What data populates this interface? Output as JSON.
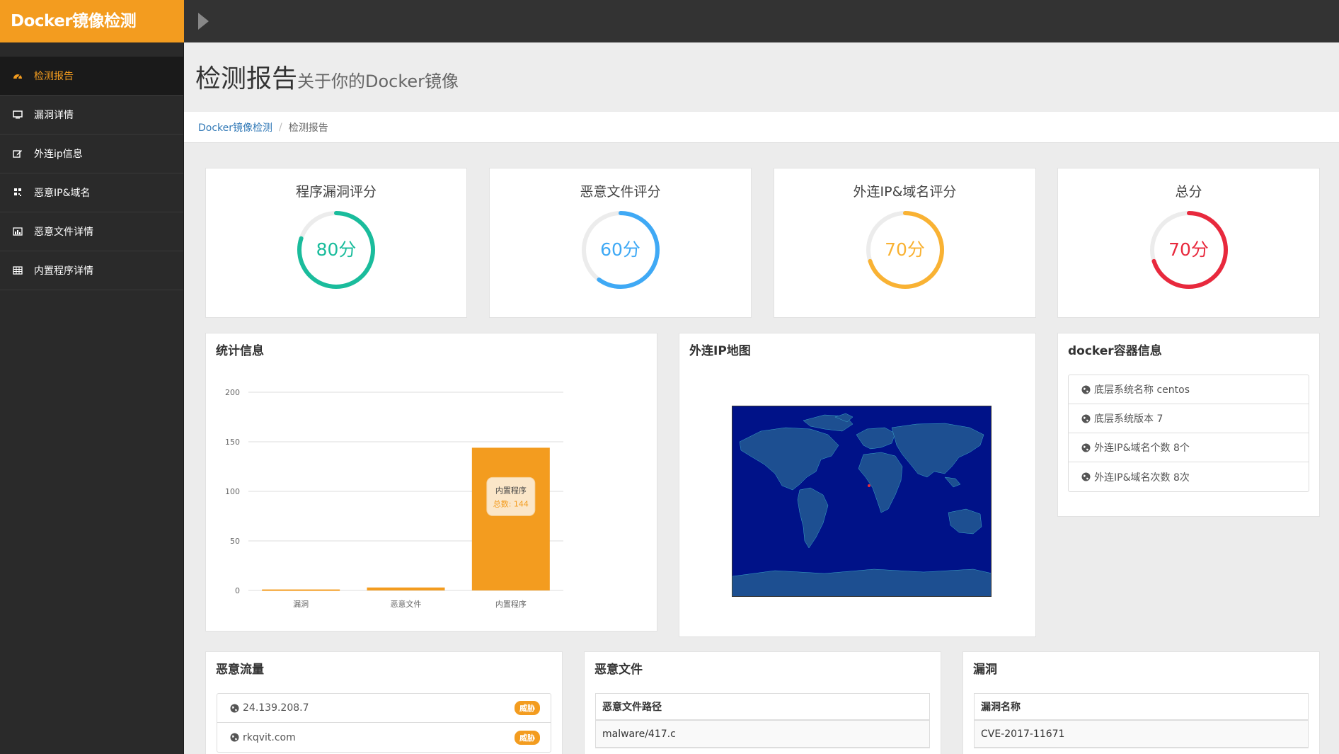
{
  "brand": "Docker镜像检测",
  "sidebar": {
    "items": [
      {
        "label": "检测报告",
        "icon": "dashboard-icon",
        "active": true
      },
      {
        "label": "漏洞详情",
        "icon": "monitor-icon"
      },
      {
        "label": "外连ip信息",
        "icon": "edit-icon"
      },
      {
        "label": "恶意IP&域名",
        "icon": "qrcode-icon"
      },
      {
        "label": "恶意文件详情",
        "icon": "bar-chart-icon"
      },
      {
        "label": "内置程序详情",
        "icon": "table-icon"
      }
    ]
  },
  "page": {
    "title": "检测报告",
    "subtitle": "关于你的Docker镜像"
  },
  "breadcrumb": {
    "home": "Docker镜像检测",
    "current": "检测报告"
  },
  "scores": [
    {
      "label": "程序漏洞评分",
      "value": 80,
      "text": "80分",
      "color": "#1abc9c"
    },
    {
      "label": "恶意文件评分",
      "value": 60,
      "text": "60分",
      "color": "#3fa9f5"
    },
    {
      "label": "外连IP&域名评分",
      "value": 70,
      "text": "70分",
      "color": "#f9b233"
    },
    {
      "label": "总分",
      "value": 70,
      "text": "70分",
      "color": "#e8293d"
    }
  ],
  "stats": {
    "title": "统计信息",
    "tooltip": {
      "name": "内置程序",
      "label": "总数: 144"
    }
  },
  "chart_data": {
    "type": "bar",
    "categories": [
      "漏洞",
      "恶意文件",
      "内置程序"
    ],
    "series": [
      {
        "values": [
          1,
          3,
          144
        ]
      }
    ],
    "ylim": [
      0,
      200
    ],
    "yticks": [
      0,
      50,
      100,
      150,
      200
    ],
    "color": "#f39c1f",
    "grid": true
  },
  "map": {
    "title": "外连IP地图"
  },
  "container": {
    "title": "docker容器信息",
    "items": [
      "底层系统名称 centos",
      "底层系统版本 7",
      "外连IP&域名个数 8个",
      "外连IP&域名次数 8次"
    ]
  },
  "malicious_traffic": {
    "title": "恶意流量",
    "items": [
      {
        "text": "24.139.208.7",
        "badge": "威胁"
      },
      {
        "text": "rkqvit.com",
        "badge": "威胁"
      }
    ]
  },
  "malicious_files": {
    "title": "恶意文件",
    "header": "恶意文件路径",
    "rows": [
      "malware/417.c"
    ]
  },
  "vulns": {
    "title": "漏洞",
    "header": "漏洞名称",
    "rows": [
      "CVE-2017-11671"
    ]
  },
  "colors": {
    "accent": "#f39c1f",
    "sidebar": "#2a2a2a",
    "topbar": "#333333"
  }
}
